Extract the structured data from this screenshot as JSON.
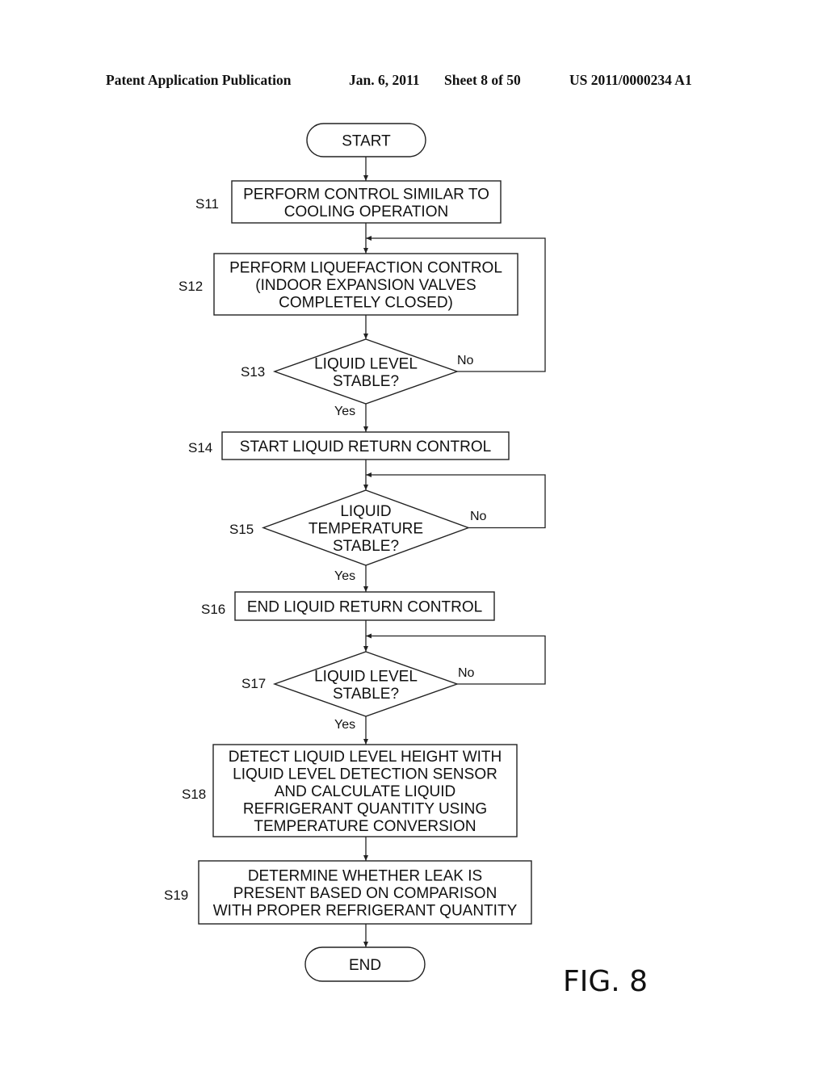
{
  "header": {
    "publication": "Patent Application Publication",
    "date": "Jan. 6, 2011",
    "sheet": "Sheet 8 of 50",
    "number": "US 2011/0000234 A1"
  },
  "figure": {
    "label": "FIG. 8"
  },
  "flowchart": {
    "start": {
      "text": "START"
    },
    "end": {
      "text": "END"
    },
    "branch_labels": {
      "yes": "Yes",
      "no": "No"
    },
    "steps": [
      {
        "id": "S11",
        "type": "process",
        "lines": [
          "PERFORM CONTROL SIMILAR TO",
          "COOLING OPERATION"
        ]
      },
      {
        "id": "S12",
        "type": "process",
        "lines": [
          "PERFORM LIQUEFACTION CONTROL",
          "(INDOOR EXPANSION VALVES",
          "COMPLETELY CLOSED)"
        ]
      },
      {
        "id": "S13",
        "type": "decision",
        "lines": [
          "LIQUID LEVEL",
          "STABLE?"
        ],
        "no_target": "S12"
      },
      {
        "id": "S14",
        "type": "process",
        "lines": [
          "START LIQUID RETURN CONTROL"
        ]
      },
      {
        "id": "S15",
        "type": "decision",
        "lines": [
          "LIQUID",
          "TEMPERATURE",
          "STABLE?"
        ],
        "no_target": "S15"
      },
      {
        "id": "S16",
        "type": "process",
        "lines": [
          "END LIQUID RETURN CONTROL"
        ]
      },
      {
        "id": "S17",
        "type": "decision",
        "lines": [
          "LIQUID LEVEL",
          "STABLE?"
        ],
        "no_target": "S17"
      },
      {
        "id": "S18",
        "type": "process",
        "lines": [
          "DETECT LIQUID LEVEL HEIGHT WITH",
          "LIQUID LEVEL DETECTION SENSOR",
          "AND CALCULATE LIQUID",
          "REFRIGERANT QUANTITY USING",
          "TEMPERATURE CONVERSION"
        ]
      },
      {
        "id": "S19",
        "type": "process",
        "lines": [
          "DETERMINE WHETHER LEAK IS",
          "PRESENT BASED ON COMPARISON",
          "WITH PROPER REFRIGERANT QUANTITY"
        ]
      }
    ]
  }
}
